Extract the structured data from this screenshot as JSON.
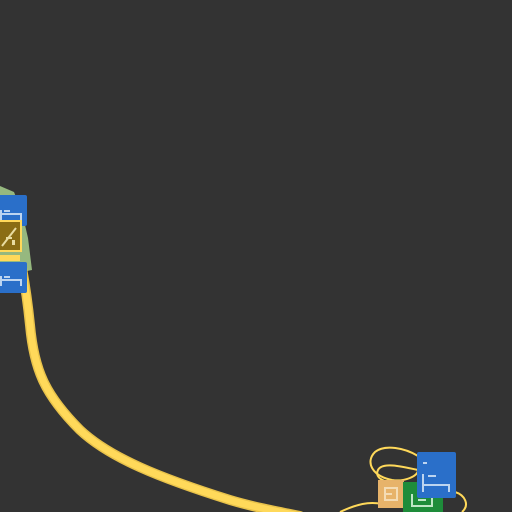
{
  "map": {
    "background_color": "#333333",
    "road_color": "#ffd95a",
    "road_casing_color": "#e8c24a",
    "park_color": "#a8d08d",
    "icons": [
      {
        "name": "hotel-icon",
        "color": "#2a6fc9"
      },
      {
        "name": "playground-icon",
        "color": "#8a6d14"
      },
      {
        "name": "hotel-icon",
        "color": "#2a6fc9"
      },
      {
        "name": "hotel-icon",
        "color": "#2a6fc9"
      },
      {
        "name": "cafe-icon",
        "color": "#e7b36a"
      },
      {
        "name": "hospital-icon",
        "color": "#1e8c3a"
      }
    ]
  }
}
